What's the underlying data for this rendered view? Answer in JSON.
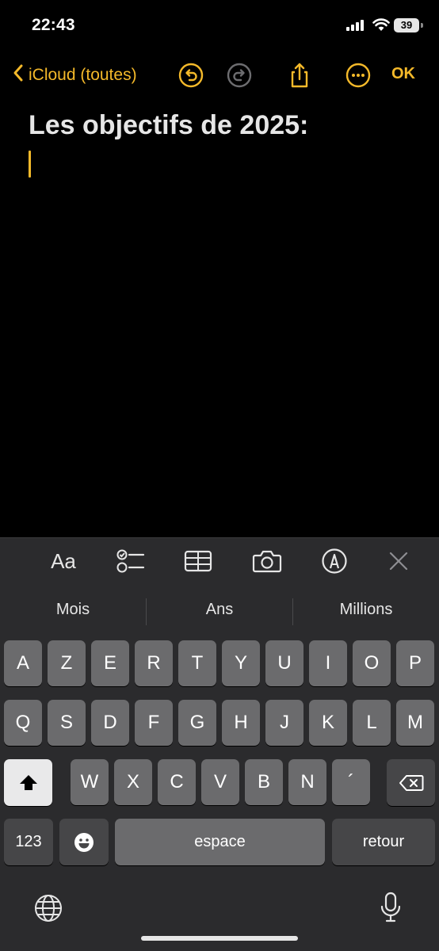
{
  "status_bar": {
    "time": "22:43",
    "battery": "39"
  },
  "nav": {
    "back_label": "iCloud (toutes)",
    "done_label": "OK"
  },
  "note": {
    "title": "Les objectifs de 2025:"
  },
  "toolbar": {
    "format_label": "Aa"
  },
  "suggestions": [
    "Mois",
    "Ans",
    "Millions"
  ],
  "keyboard": {
    "row1": [
      "A",
      "Z",
      "E",
      "R",
      "T",
      "Y",
      "U",
      "I",
      "O",
      "P"
    ],
    "row2": [
      "Q",
      "S",
      "D",
      "F",
      "G",
      "H",
      "J",
      "K",
      "L",
      "M"
    ],
    "row3": [
      "W",
      "X",
      "C",
      "V",
      "B",
      "N",
      "´"
    ],
    "numbers_label": "123",
    "space_label": "espace",
    "return_label": "retour"
  },
  "colors": {
    "accent": "#f4b92a",
    "background": "#000000",
    "keyboard": "#2b2b2d"
  }
}
